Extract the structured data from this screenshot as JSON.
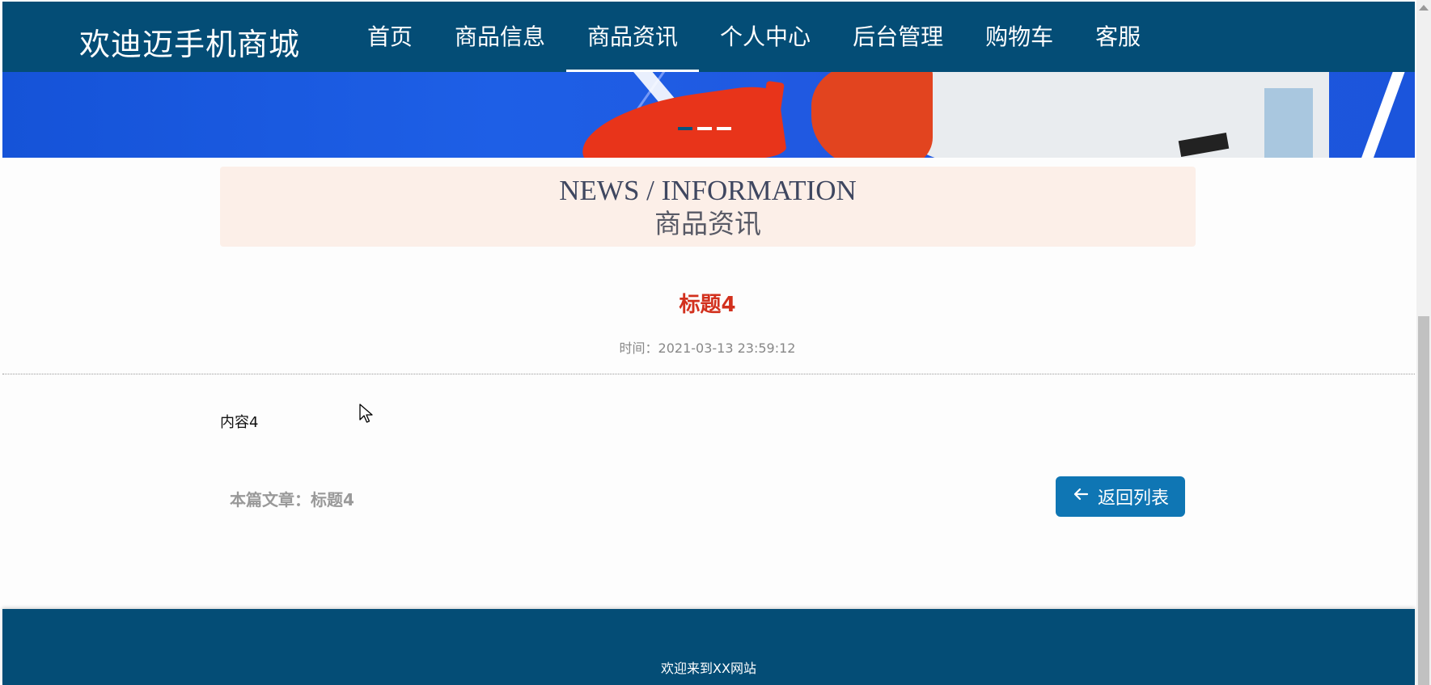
{
  "nav": {
    "brand": "欢迪迈手机商城",
    "items": [
      {
        "label": "首页"
      },
      {
        "label": "商品信息"
      },
      {
        "label": "商品资讯",
        "active": true
      },
      {
        "label": "个人中心"
      },
      {
        "label": "后台管理"
      },
      {
        "label": "购物车"
      },
      {
        "label": "客服"
      }
    ]
  },
  "banner": {
    "active_dot": 1,
    "dot_count": 3
  },
  "section": {
    "en": "NEWS / INFORMATION",
    "zh": "商品资讯"
  },
  "article": {
    "title": "标题4",
    "time": "时间：2021-03-13 23:59:12",
    "content": "内容4",
    "current_label": "本篇文章：标题4"
  },
  "back_button": {
    "label": "返回列表",
    "icon": "arrow-left-icon"
  },
  "footer": {
    "text": "欢迎来到XX网站"
  },
  "colors": {
    "nav_bg": "#044d76",
    "title_red": "#d2301d",
    "button_blue": "#0f76b4",
    "section_bg": "#fcefe8"
  }
}
